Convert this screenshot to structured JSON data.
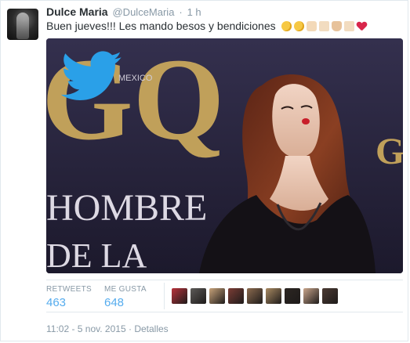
{
  "tweet": {
    "author_name": "Dulce Maria",
    "author_handle": "@DulceMaria",
    "separator": "·",
    "time": "1 h",
    "text": "Buen jueves!!! Les mando besos y bendiciones",
    "emojis": [
      "kiss-emoji",
      "kiss-emoji",
      "raised-hands-emoji",
      "skin-tone-emoji",
      "folded-hands-emoji",
      "skin-tone-emoji",
      "red-heart-emoji"
    ]
  },
  "media": {
    "icon": "twitter-bird-icon",
    "backdrop_text": [
      "GQ",
      "MEXICO",
      "HOMBRE",
      "DE LA",
      "G"
    ]
  },
  "stats": {
    "retweets_label": "RETWEETS",
    "retweets_value": "463",
    "likes_label": "ME GUSTA",
    "likes_value": "648",
    "liker_avatar_colors": [
      "#b8323b",
      "#5d5a58",
      "#c7a27a",
      "#7b3d35",
      "#8c6b4f",
      "#a98a62",
      "#2c2622",
      "#c9a58b",
      "#4b3a33"
    ]
  },
  "footer": {
    "timestamp": "11:02 - 5 nov. 2015",
    "separator": "·",
    "details_label": "Detalles"
  },
  "colors": {
    "accent": "#55acee",
    "muted": "#8899a6",
    "text": "#292f33",
    "gold": "#c9a75c"
  }
}
